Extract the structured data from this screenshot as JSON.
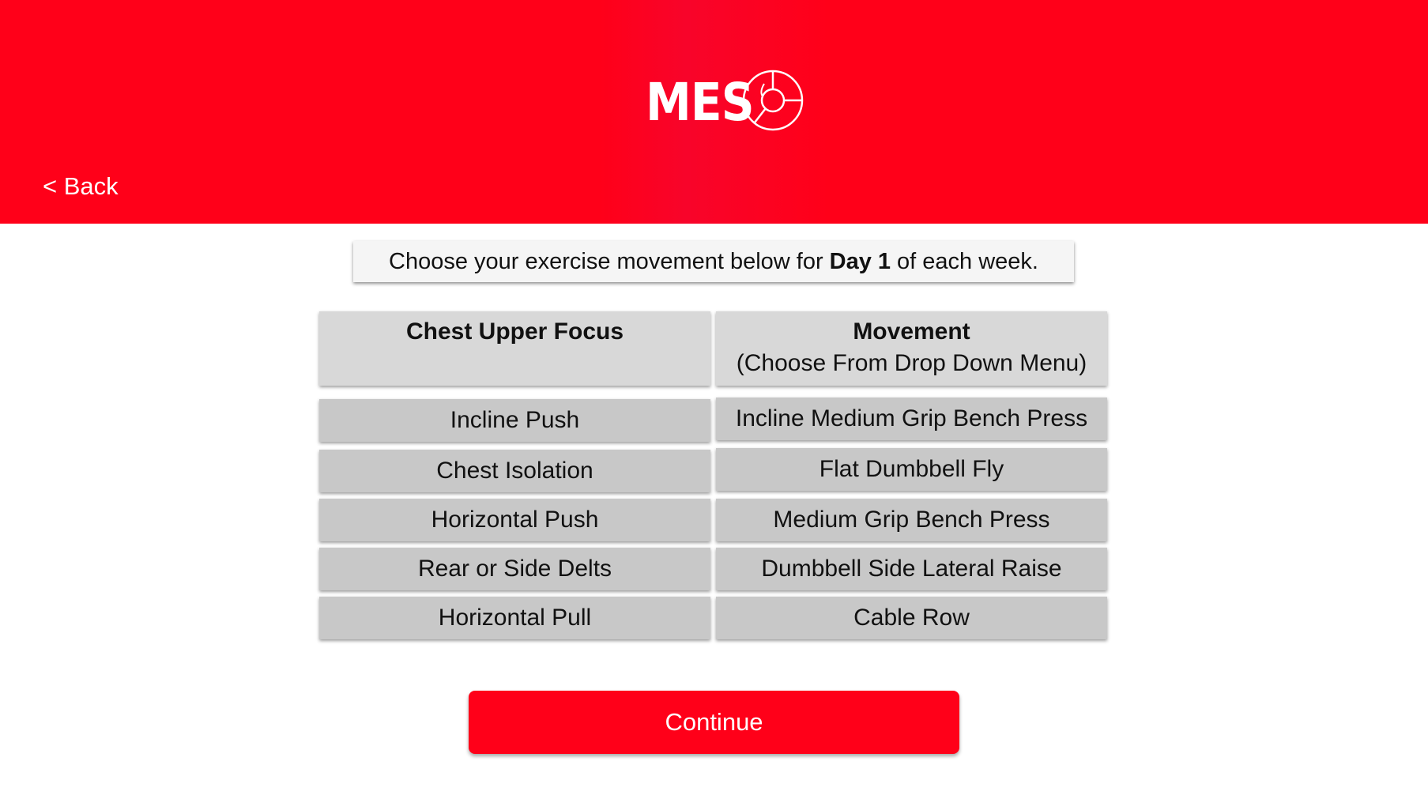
{
  "header": {
    "logo_text": "MES",
    "back_label": "< Back"
  },
  "instruction": {
    "prefix": "Choose your exercise movement below for",
    "day": "Day 1",
    "suffix": "of each week."
  },
  "table": {
    "left_header": "Chest Upper Focus",
    "right_header": "Movement",
    "right_subheader": "(Choose From Drop Down Menu)",
    "rows": [
      {
        "focus": "Incline Push",
        "movement": "Incline Medium Grip Bench Press"
      },
      {
        "focus": "Chest Isolation",
        "movement": "Flat Dumbbell Fly"
      },
      {
        "focus": "Horizontal Push",
        "movement": "Medium Grip Bench Press"
      },
      {
        "focus": "Rear or Side Delts",
        "movement": "Dumbbell Side Lateral Raise"
      },
      {
        "focus": "Horizontal Pull",
        "movement": "Cable Row"
      }
    ]
  },
  "continue_label": "Continue",
  "colors": {
    "brand_red": "#ff0019",
    "header_cell": "#d8d8d8",
    "row_cell": "#c8c8c8"
  }
}
